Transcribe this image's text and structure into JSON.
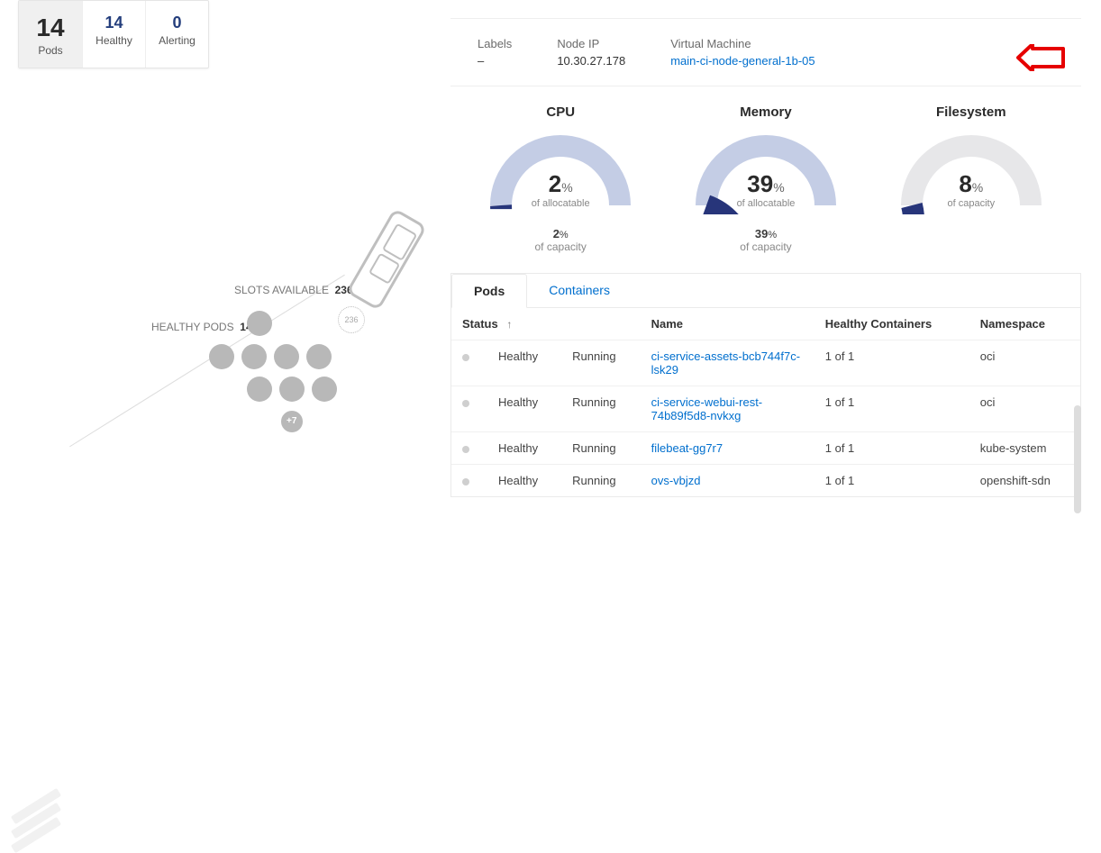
{
  "summary": {
    "pods_count": "14",
    "pods_label": "Pods",
    "healthy_count": "14",
    "healthy_label": "Healthy",
    "alerting_count": "0",
    "alerting_label": "Alerting"
  },
  "slots": {
    "slots_label": "SLOTS AVAILABLE",
    "slots_value": "236",
    "healthy_label": "HEALTHY PODS",
    "healthy_value": "14",
    "device_badge": "236",
    "overlay_badge": "+7"
  },
  "info": {
    "labels_label": "Labels",
    "labels_value": "–",
    "nodeip_label": "Node IP",
    "nodeip_value": "10.30.27.178",
    "vm_label": "Virtual Machine",
    "vm_value": "main-ci-node-general-1b-05"
  },
  "chart_data": [
    {
      "type": "gauge",
      "title": "CPU",
      "value_pct_allocatable": 2,
      "value_pct_capacity": 2,
      "range": [
        0,
        100
      ],
      "color_track": "#c4cde5",
      "color_fill": "#27357a",
      "sub_alloc": "of allocatable",
      "sub_cap": "of capacity"
    },
    {
      "type": "gauge",
      "title": "Memory",
      "value_pct_allocatable": 39,
      "value_pct_capacity": 39,
      "range": [
        0,
        100
      ],
      "color_track": "#c4cde5",
      "color_fill": "#27357a",
      "sub_alloc": "of allocatable",
      "sub_cap": "of capacity"
    },
    {
      "type": "gauge",
      "title": "Filesystem",
      "value_pct_allocatable": 8,
      "value_pct_capacity": null,
      "range": [
        0,
        100
      ],
      "color_track": "#e7e7e9",
      "color_fill": "#27357a",
      "sub_alloc": "of capacity",
      "sub_cap": ""
    }
  ],
  "tabs": {
    "pods": "Pods",
    "containers": "Containers"
  },
  "table": {
    "headers": {
      "status": "Status",
      "state": "",
      "name": "Name",
      "hc": "Healthy Containers",
      "ns": "Namespace"
    },
    "rows": [
      {
        "status": "Healthy",
        "state": "Running",
        "name": "ci-service-assets-bcb744f7c-lsk29",
        "hc": "1 of 1",
        "ns": "oci"
      },
      {
        "status": "Healthy",
        "state": "Running",
        "name": "ci-service-webui-rest-74b89f5d8-nvkxg",
        "hc": "1 of 1",
        "ns": "oci"
      },
      {
        "status": "Healthy",
        "state": "Running",
        "name": "filebeat-gg7r7",
        "hc": "1 of 1",
        "ns": "kube-system"
      },
      {
        "status": "Healthy",
        "state": "Running",
        "name": "ovs-vbjzd",
        "hc": "1 of 1",
        "ns": "openshift-sdn"
      }
    ]
  }
}
